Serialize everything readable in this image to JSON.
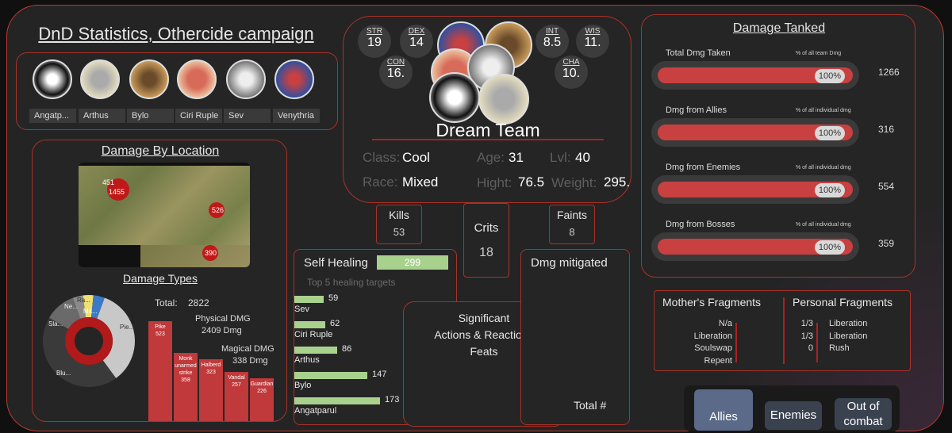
{
  "page_title": "DnD Statistics, Othercide campaign",
  "characters": [
    {
      "name": "Angatp...",
      "color": "#e8e8e8"
    },
    {
      "name": "Arthus",
      "color": "#c8c8b8"
    },
    {
      "name": "Bylo",
      "color": "#c89a5a"
    },
    {
      "name": "Ciri Ruple",
      "color": "#d86a5a"
    },
    {
      "name": "Sev",
      "color": "#bdbdbd"
    },
    {
      "name": "Venythria",
      "color": "#5570b0"
    }
  ],
  "location": {
    "title": "Damage By Location",
    "markers": [
      {
        "label": "451",
        "value": 451
      },
      {
        "label": "1455",
        "value": 1455
      },
      {
        "label": "526",
        "value": 526
      },
      {
        "label": "390",
        "value": 390
      }
    ]
  },
  "damage_types": {
    "title": "Damage Types",
    "total_label": "Total:",
    "total_value": "2822",
    "physical_label": "Physical DMG",
    "physical_value": "2409 Dmg",
    "magical_label": "Magical DMG",
    "magical_value": "338 Dmg",
    "donut_labels": [
      "Pie...",
      "Blu...",
      "Sla...",
      "Ne...",
      "Ra...",
      "Ma..."
    ],
    "bars": [
      {
        "label": "Pike",
        "value": "523",
        "num": 523
      },
      {
        "label": "Monk unarmed strike",
        "value": "358",
        "num": 358
      },
      {
        "label": "Halberd",
        "value": "323",
        "num": 323
      },
      {
        "label": "Vandal",
        "value": "257",
        "num": 257
      },
      {
        "label": "Guardian",
        "value": "226",
        "num": 226
      }
    ]
  },
  "team": {
    "name": "Dream Team",
    "stats": [
      {
        "key": "STR",
        "value": "19"
      },
      {
        "key": "DEX",
        "value": "14"
      },
      {
        "key": "CON",
        "value": "16."
      },
      {
        "key": "INT",
        "value": "8.5"
      },
      {
        "key": "WIS",
        "value": "11."
      },
      {
        "key": "CHA",
        "value": "10."
      }
    ],
    "class_label": "Class:",
    "class_value": "Cool",
    "age_label": "Age:",
    "age_value": "31",
    "lvl_label": "Lvl:",
    "lvl_value": "40",
    "race_label": "Race:",
    "race_value": "Mixed",
    "hight_label": "Hight:",
    "hight_value": "76.5",
    "weight_label": "Weight:",
    "weight_value": "295."
  },
  "kills": {
    "label": "Kills",
    "value": "53"
  },
  "crits": {
    "label": "Crits",
    "value": "18"
  },
  "faints": {
    "label": "Faints",
    "value": "8"
  },
  "healing": {
    "title": "Self Healing",
    "value": "299",
    "subtitle": "Top 5 healing targets",
    "targets": [
      {
        "name": "Sev",
        "value": "59",
        "num": 59
      },
      {
        "name": "Ciri Ruple",
        "value": "62",
        "num": 62
      },
      {
        "name": "Arthus",
        "value": "86",
        "num": 86
      },
      {
        "name": "Bylo",
        "value": "147",
        "num": 147
      },
      {
        "name": "Angatparul",
        "value": "173",
        "num": 173
      }
    ]
  },
  "significant": {
    "line1": "Significant",
    "line2": "Actions & Reactions",
    "line3": "Feats"
  },
  "mitigated": {
    "title": "Dmg mitigated",
    "total": "Total #"
  },
  "tanked": {
    "title": "Damage Tanked",
    "rows": [
      {
        "label": "Total Dmg Taken",
        "note": "% of all team Dmg",
        "pct": "100%",
        "value": "1266"
      },
      {
        "label": "Dmg from Allies",
        "note": "% of all individual dmg",
        "pct": "100%",
        "value": "316"
      },
      {
        "label": "Dmg from Enemies",
        "note": "% of all individual dmg",
        "pct": "100%",
        "value": "554"
      },
      {
        "label": "Dmg from Bosses",
        "note": "% of all individual dmg",
        "pct": "100%",
        "value": "359"
      }
    ]
  },
  "fragments": {
    "mother_title": "Mother's Fragments",
    "personal_title": "Personal Fragments",
    "mother_items": [
      "N/a",
      "Liberation",
      "Soulswap",
      "Repent"
    ],
    "personal_items": [
      {
        "count": "1/3",
        "name": "Liberation"
      },
      {
        "count": "1/3",
        "name": "Liberation"
      },
      {
        "count": "0",
        "name": "Rush"
      }
    ]
  },
  "buttons": {
    "allies": "Allies",
    "enemies": "Enemies",
    "out_of_combat": "Out of combat"
  },
  "colors": {
    "accent": "#c0392b",
    "bar": "#c94040",
    "heal": "#a9d18e",
    "panel": "#252525"
  }
}
